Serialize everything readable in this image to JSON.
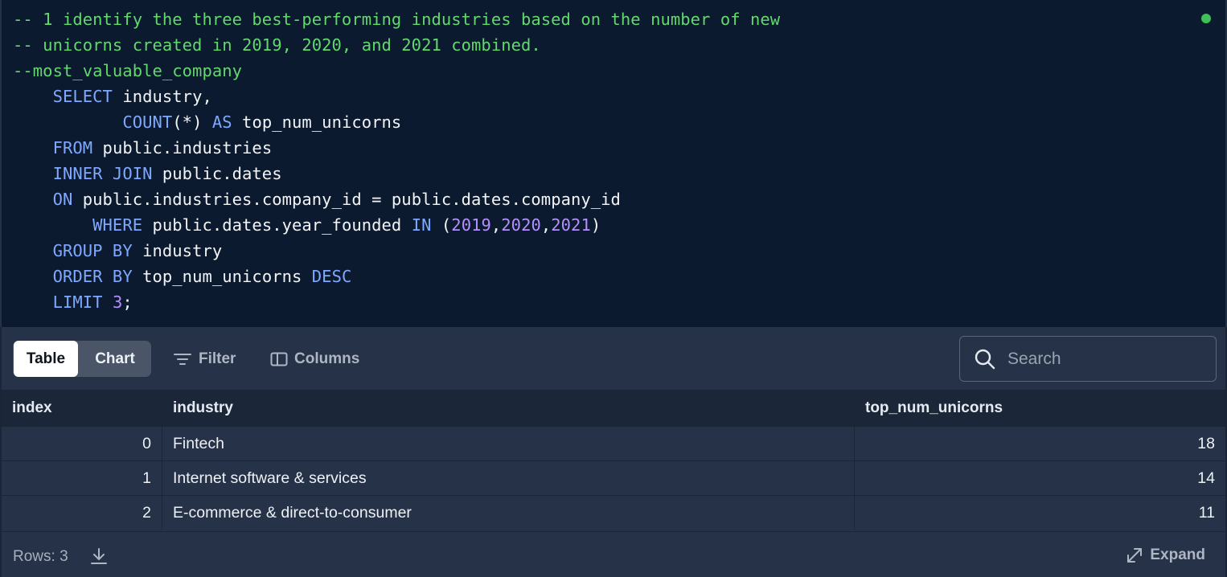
{
  "editor": {
    "lines": [
      [
        {
          "t": "-- 1 identify the three best-performing industries based on the number of new",
          "c": "comment"
        }
      ],
      [
        {
          "t": "-- unicorns created in 2019, 2020, and 2021 combined.",
          "c": "comment"
        }
      ],
      [
        {
          "t": "--most_valuable_company",
          "c": "comment"
        }
      ],
      [
        {
          "t": "    ",
          "c": "id"
        },
        {
          "t": "SELECT",
          "c": "kw"
        },
        {
          "t": " industry,",
          "c": "id"
        }
      ],
      [
        {
          "t": "           ",
          "c": "id"
        },
        {
          "t": "COUNT",
          "c": "kw"
        },
        {
          "t": "(*) ",
          "c": "id"
        },
        {
          "t": "AS",
          "c": "kw"
        },
        {
          "t": " top_num_unicorns",
          "c": "id"
        }
      ],
      [
        {
          "t": "    ",
          "c": "id"
        },
        {
          "t": "FROM",
          "c": "kw"
        },
        {
          "t": " public.industries",
          "c": "id"
        }
      ],
      [
        {
          "t": "    ",
          "c": "id"
        },
        {
          "t": "INNER JOIN",
          "c": "kw"
        },
        {
          "t": " public.dates",
          "c": "id"
        }
      ],
      [
        {
          "t": "    ",
          "c": "id"
        },
        {
          "t": "ON",
          "c": "kw"
        },
        {
          "t": " public.industries.company_id = public.dates.company_id",
          "c": "id"
        }
      ],
      [
        {
          "t": "        ",
          "c": "id"
        },
        {
          "t": "WHERE",
          "c": "kw"
        },
        {
          "t": " public.dates.year_founded ",
          "c": "id"
        },
        {
          "t": "IN",
          "c": "kw"
        },
        {
          "t": " (",
          "c": "id"
        },
        {
          "t": "2019",
          "c": "num"
        },
        {
          "t": ",",
          "c": "id"
        },
        {
          "t": "2020",
          "c": "num"
        },
        {
          "t": ",",
          "c": "id"
        },
        {
          "t": "2021",
          "c": "num"
        },
        {
          "t": ")",
          "c": "id"
        }
      ],
      [
        {
          "t": "    ",
          "c": "id"
        },
        {
          "t": "GROUP BY",
          "c": "kw"
        },
        {
          "t": " industry",
          "c": "id"
        }
      ],
      [
        {
          "t": "    ",
          "c": "id"
        },
        {
          "t": "ORDER BY",
          "c": "kw"
        },
        {
          "t": " top_num_unicorns ",
          "c": "id"
        },
        {
          "t": "DESC",
          "c": "kw"
        }
      ],
      [
        {
          "t": "    ",
          "c": "id"
        },
        {
          "t": "LIMIT",
          "c": "kw"
        },
        {
          "t": " ",
          "c": "id"
        },
        {
          "t": "3",
          "c": "num"
        },
        {
          "t": ";",
          "c": "id"
        }
      ]
    ],
    "status_color": "#3fbf56"
  },
  "toolbar": {
    "view_table": "Table",
    "view_chart": "Chart",
    "filter_label": "Filter",
    "columns_label": "Columns",
    "search_placeholder": "Search"
  },
  "table": {
    "columns": [
      "index",
      "industry",
      "top_num_unicorns"
    ],
    "rows": [
      {
        "index": "0",
        "industry": "Fintech",
        "top_num_unicorns": "18"
      },
      {
        "index": "1",
        "industry": "Internet software & services",
        "top_num_unicorns": "14"
      },
      {
        "index": "2",
        "industry": "E-commerce & direct-to-consumer",
        "top_num_unicorns": "11"
      }
    ]
  },
  "footer": {
    "rows_label": "Rows: 3",
    "expand_label": "Expand"
  }
}
